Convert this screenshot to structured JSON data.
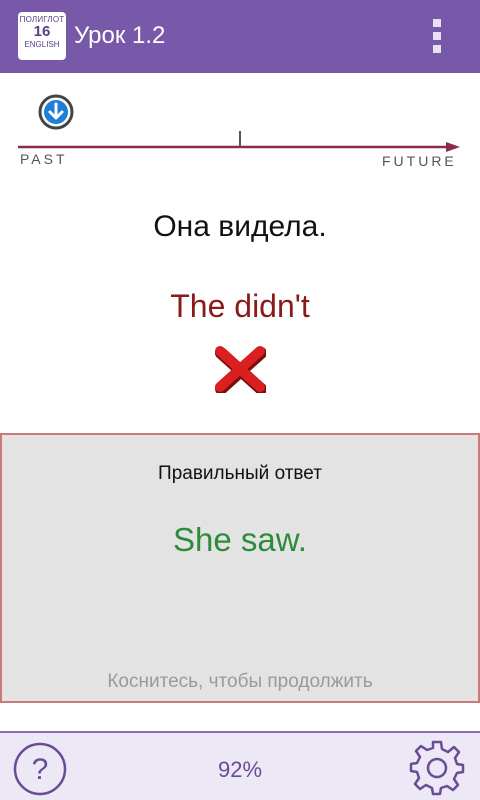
{
  "topbar": {
    "logo_top": "ПОЛИГЛОТ",
    "logo_number": "16",
    "logo_bottom": "ENGLISH",
    "title": "Урок 1.2"
  },
  "timeline": {
    "past_label": "PAST",
    "future_label": "FUTURE"
  },
  "exercise": {
    "question": "Она видела.",
    "user_answer": "The didn't",
    "result_icon": "red-x-icon"
  },
  "answer_panel": {
    "title": "Правильный ответ",
    "correct_answer": "She saw.",
    "hint": "Коснитесь, чтобы продолжить"
  },
  "bottombar": {
    "progress": "92%"
  },
  "colors": {
    "header": "#7858a8",
    "timeline": "#8b2a4a",
    "wrong": "#d91f1f",
    "correct": "#2e8b3a"
  }
}
